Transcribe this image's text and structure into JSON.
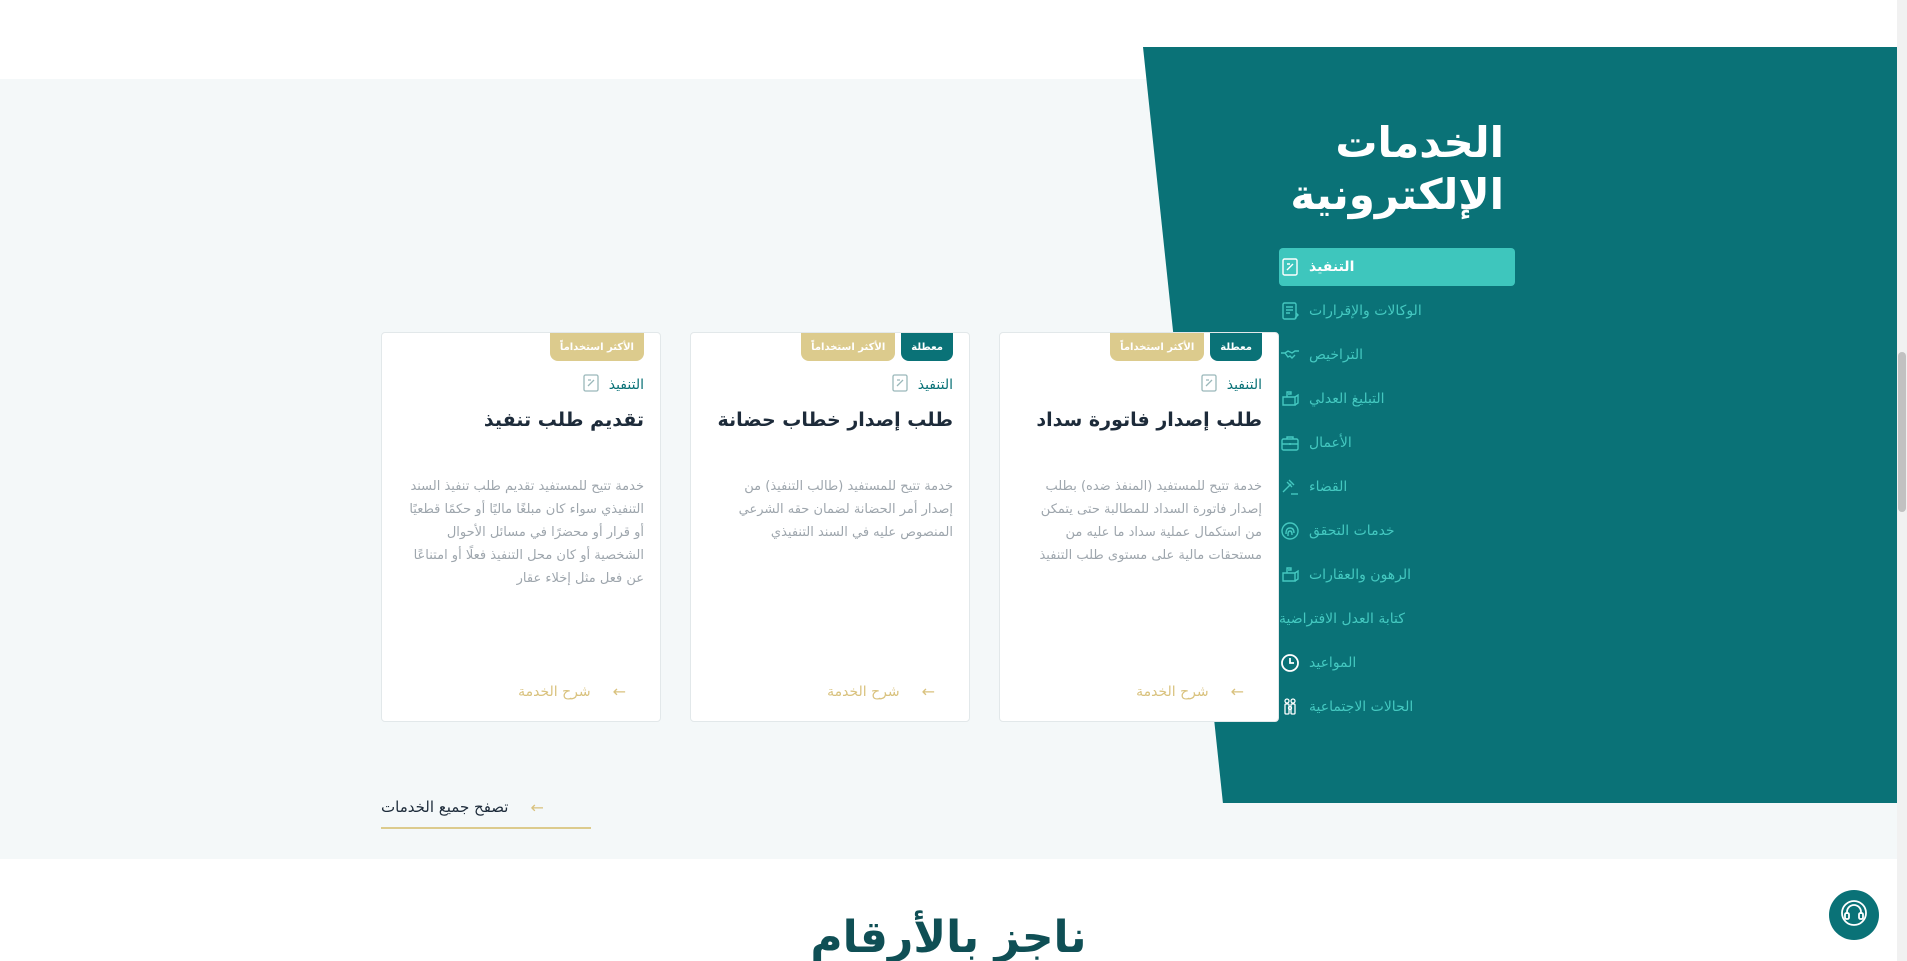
{
  "panel": {
    "title_line1": "الخدمات",
    "title_line2": "الإلكترونية",
    "nav": [
      {
        "label": "التنفيذ",
        "icon": "document-icon",
        "active": true
      },
      {
        "label": "الوكالات والإقرارات",
        "icon": "contract-icon",
        "active": false
      },
      {
        "label": "التراخيص",
        "icon": "handshake-icon",
        "active": false
      },
      {
        "label": "التبليغ العدلي",
        "icon": "mailbox-icon",
        "active": false
      },
      {
        "label": "الأعمال",
        "icon": "briefcase-icon",
        "active": false
      },
      {
        "label": "القضاء",
        "icon": "gavel-icon",
        "active": false
      },
      {
        "label": "خدمات التحقق",
        "icon": "fingerprint-icon",
        "active": false
      },
      {
        "label": "الرهون والعقارات",
        "icon": "mailbox-icon",
        "active": false
      },
      {
        "label": "كتابة العدل الافتراضية",
        "icon": "",
        "active": false
      },
      {
        "label": "المواعيد",
        "icon": "clock-icon",
        "active": false
      },
      {
        "label": "الحالات الاجتماعية",
        "icon": "family-icon",
        "active": false
      }
    ]
  },
  "cards": [
    {
      "badge_disabled": "معطلة",
      "badge_popular": "الأكثر استخداماً",
      "category": "التنفيذ",
      "title": "طلب إصدار فاتورة سداد",
      "description": "خدمة تتيح للمستفيد (المنفذ ضده) بطلب إصدار فاتورة السداد للمطالبة حتى يتمكن من استكمال عملية سداد ما عليه من مستحقات مالية على مستوى طلب التنفيذ",
      "link": "شرح الخدمة"
    },
    {
      "badge_disabled": "معطلة",
      "badge_popular": "الأكثر استخداماً",
      "category": "التنفيذ",
      "title": "طلب إصدار خطاب حضانة",
      "description": "خدمة تتيح للمستفيد (طالب التنفيذ) من إصدار أمر الحضانة لضمان حقه الشرعي المنصوص عليه في السند التنفيذي",
      "link": "شرح الخدمة"
    },
    {
      "badge_disabled": "",
      "badge_popular": "الأكثر استخداماً",
      "category": "التنفيذ",
      "title": "تقديم طلب تنفيذ",
      "description": "خدمة تتيح للمستفيد تقديم طلب تنفيذ السند التنفيذي سواء كان مبلغًا ماليًا أو حكمًا قطعيًا أو قرار أو محضرًا في مسائل الأحوال الشخصية أو كان محل التنفيذ فعلًا أو امتناعًا عن فعل مثل إخلاء عقار",
      "link": "شرح الخدمة"
    }
  ],
  "browse_all": "تصفح جميع الخدمات",
  "stats_heading": "ناجز بالأرقام",
  "colors": {
    "teal": "#0a7277",
    "teal_light": "#3ec6bd",
    "gold": "#dccb8d",
    "text_dark": "#1d2b3a",
    "text_muted": "#9ea6ad"
  }
}
